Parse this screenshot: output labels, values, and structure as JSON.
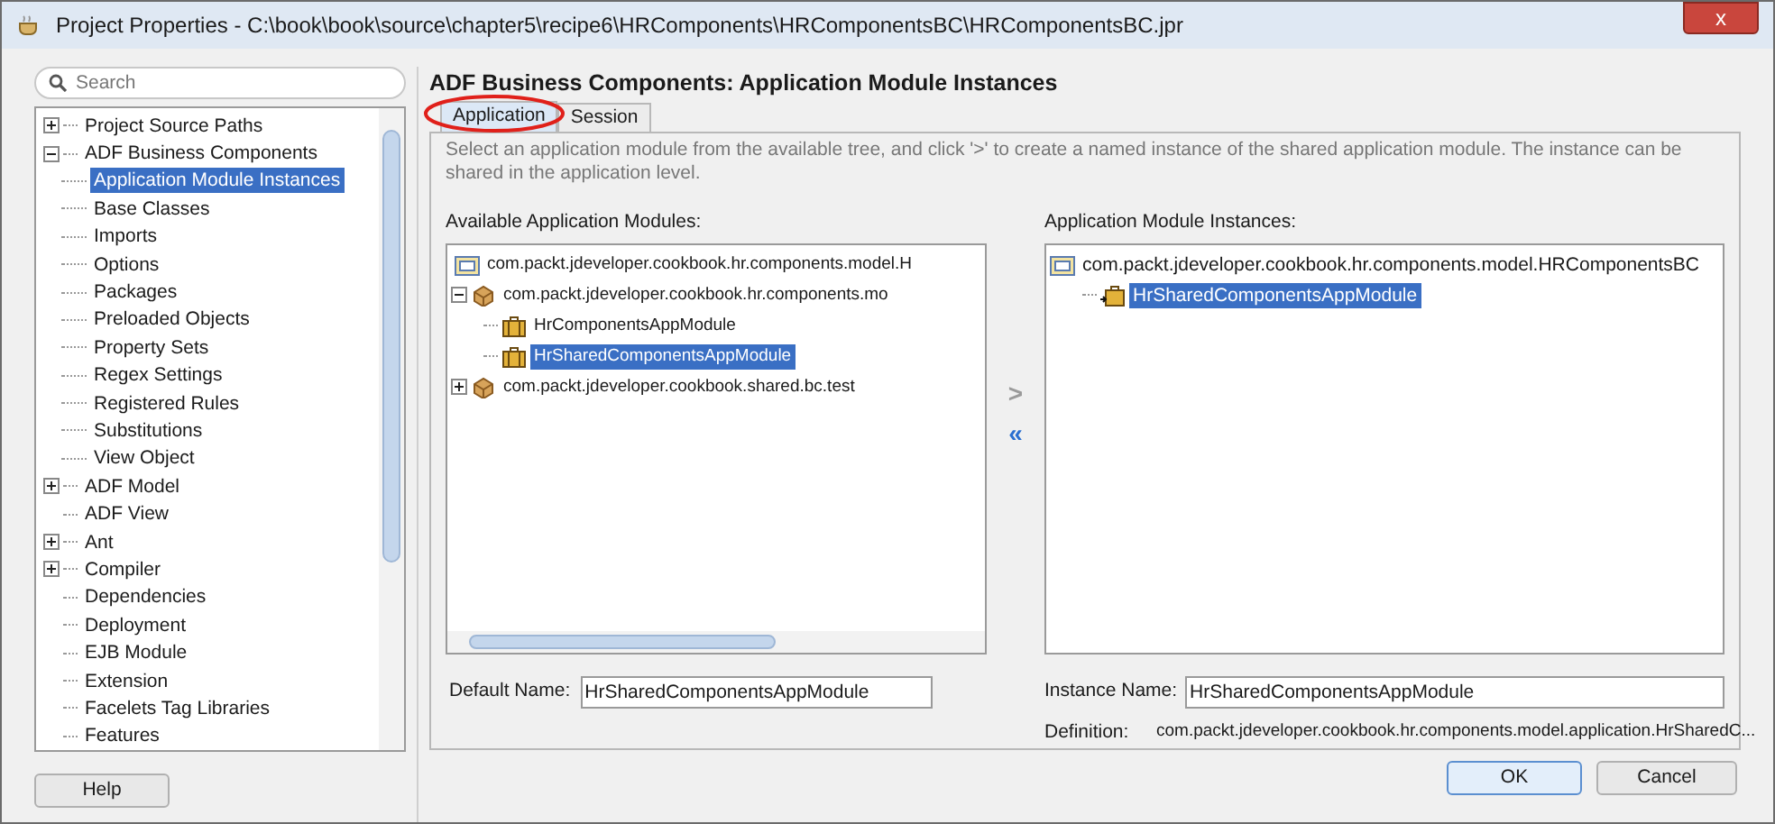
{
  "window": {
    "title": "Project Properties - C:\\book\\book\\source\\chapter5\\recipe6\\HRComponents\\HRComponentsBC\\HRComponentsBC.jpr",
    "close": "x"
  },
  "search": {
    "placeholder": "Search"
  },
  "nav_tree": [
    {
      "label": "Project Source Paths",
      "expanded": false,
      "selected": false
    },
    {
      "label": "ADF Business Components",
      "expanded": true,
      "selected": false,
      "children": [
        {
          "label": "Application Module Instances",
          "selected": true
        },
        {
          "label": "Base Classes",
          "selected": false
        },
        {
          "label": "Imports",
          "selected": false
        },
        {
          "label": "Options",
          "selected": false
        },
        {
          "label": "Packages",
          "selected": false
        },
        {
          "label": "Preloaded Objects",
          "selected": false
        },
        {
          "label": "Property Sets",
          "selected": false
        },
        {
          "label": "Regex Settings",
          "selected": false
        },
        {
          "label": "Registered Rules",
          "selected": false
        },
        {
          "label": "Substitutions",
          "selected": false
        },
        {
          "label": "View Object",
          "selected": false
        }
      ]
    },
    {
      "label": "ADF Model",
      "expanded": false,
      "selected": false
    },
    {
      "label": "ADF View",
      "selected": false
    },
    {
      "label": "Ant",
      "expanded": false,
      "selected": false
    },
    {
      "label": "Compiler",
      "expanded": false,
      "selected": false
    },
    {
      "label": "Dependencies",
      "selected": false
    },
    {
      "label": "Deployment",
      "selected": false
    },
    {
      "label": "EJB Module",
      "selected": false
    },
    {
      "label": "Extension",
      "selected": false
    },
    {
      "label": "Facelets Tag Libraries",
      "selected": false
    },
    {
      "label": "Features",
      "selected": false
    }
  ],
  "heading": "ADF Business Components: Application Module Instances",
  "tabs": [
    {
      "label": "Application",
      "selected": true
    },
    {
      "label": "Session",
      "selected": false
    }
  ],
  "description": "Select an application module from the available tree, and click '>' to create a named instance of the shared application module. The instance can be shared in the application level.",
  "available": {
    "label": "Available Application Modules:",
    "tree": [
      {
        "kind": "folder",
        "label": "com.packt.jdeveloper.cookbook.hr.components.model.H",
        "selected": false
      },
      {
        "kind": "package",
        "label": "com.packt.jdeveloper.cookbook.hr.components.mo",
        "expanded": true,
        "selected": false,
        "children": [
          {
            "kind": "module",
            "label": "HrComponentsAppModule",
            "selected": false
          },
          {
            "kind": "module",
            "label": "HrSharedComponentsAppModule",
            "selected": true
          }
        ]
      },
      {
        "kind": "package",
        "label": "com.packt.jdeveloper.cookbook.shared.bc.test",
        "expanded": false,
        "selected": false
      }
    ]
  },
  "move_buttons": [
    {
      "label": ">",
      "disabled": true
    },
    {
      "label": "«",
      "disabled": false
    }
  ],
  "instances": {
    "label": "Application Module Instances:",
    "tree": [
      {
        "kind": "folder",
        "label": "com.packt.jdeveloper.cookbook.hr.components.model.HRComponentsBC",
        "selected": false,
        "children": [
          {
            "kind": "instance",
            "label": "HrSharedComponentsAppModule",
            "selected": true
          }
        ]
      }
    ]
  },
  "default_name": {
    "label": "Default Name:",
    "value": "HrSharedComponentsAppModule"
  },
  "instance_name": {
    "label": "Instance Name:",
    "value": "HrSharedComponentsAppModule"
  },
  "definition": {
    "label": "Definition:",
    "value": "com.packt.jdeveloper.cookbook.hr.components.model.application.HrSharedC..."
  },
  "buttons": [
    {
      "label": "Help",
      "default": false
    },
    {
      "label": "OK",
      "default": true
    },
    {
      "label": "Cancel",
      "default": false
    }
  ]
}
